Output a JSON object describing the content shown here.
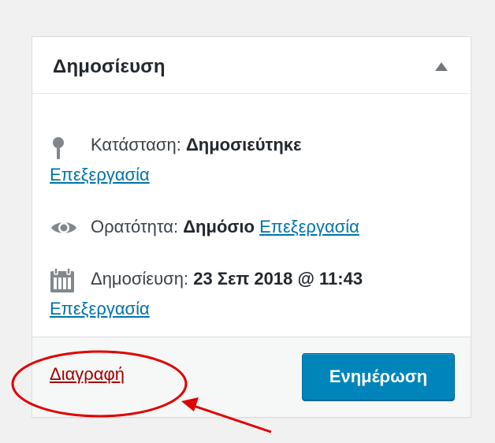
{
  "panel": {
    "title": "Δημοσίευση",
    "toggle_icon": "triangle-up-icon"
  },
  "status": {
    "icon": "pin-icon",
    "label": "Κατάσταση:",
    "value": "Δημοσιεύτηκε",
    "edit_label": "Επεξεργασία"
  },
  "visibility": {
    "icon": "eye-icon",
    "label": "Ορατότητα:",
    "value": "Δημόσιο",
    "edit_label": "Επεξεργασία"
  },
  "publish": {
    "icon": "calendar-icon",
    "label": "Δημοσίευση:",
    "value": "23 Σεπ 2018 @ 11:43",
    "edit_label": "Επεξεργασία"
  },
  "footer": {
    "delete_label": "Διαγραφή",
    "update_label": "Ενημέρωση"
  },
  "colors": {
    "link": "#0073aa",
    "delete": "#a00000",
    "primary_button": "#0085ba",
    "annotation": "#e00000"
  }
}
